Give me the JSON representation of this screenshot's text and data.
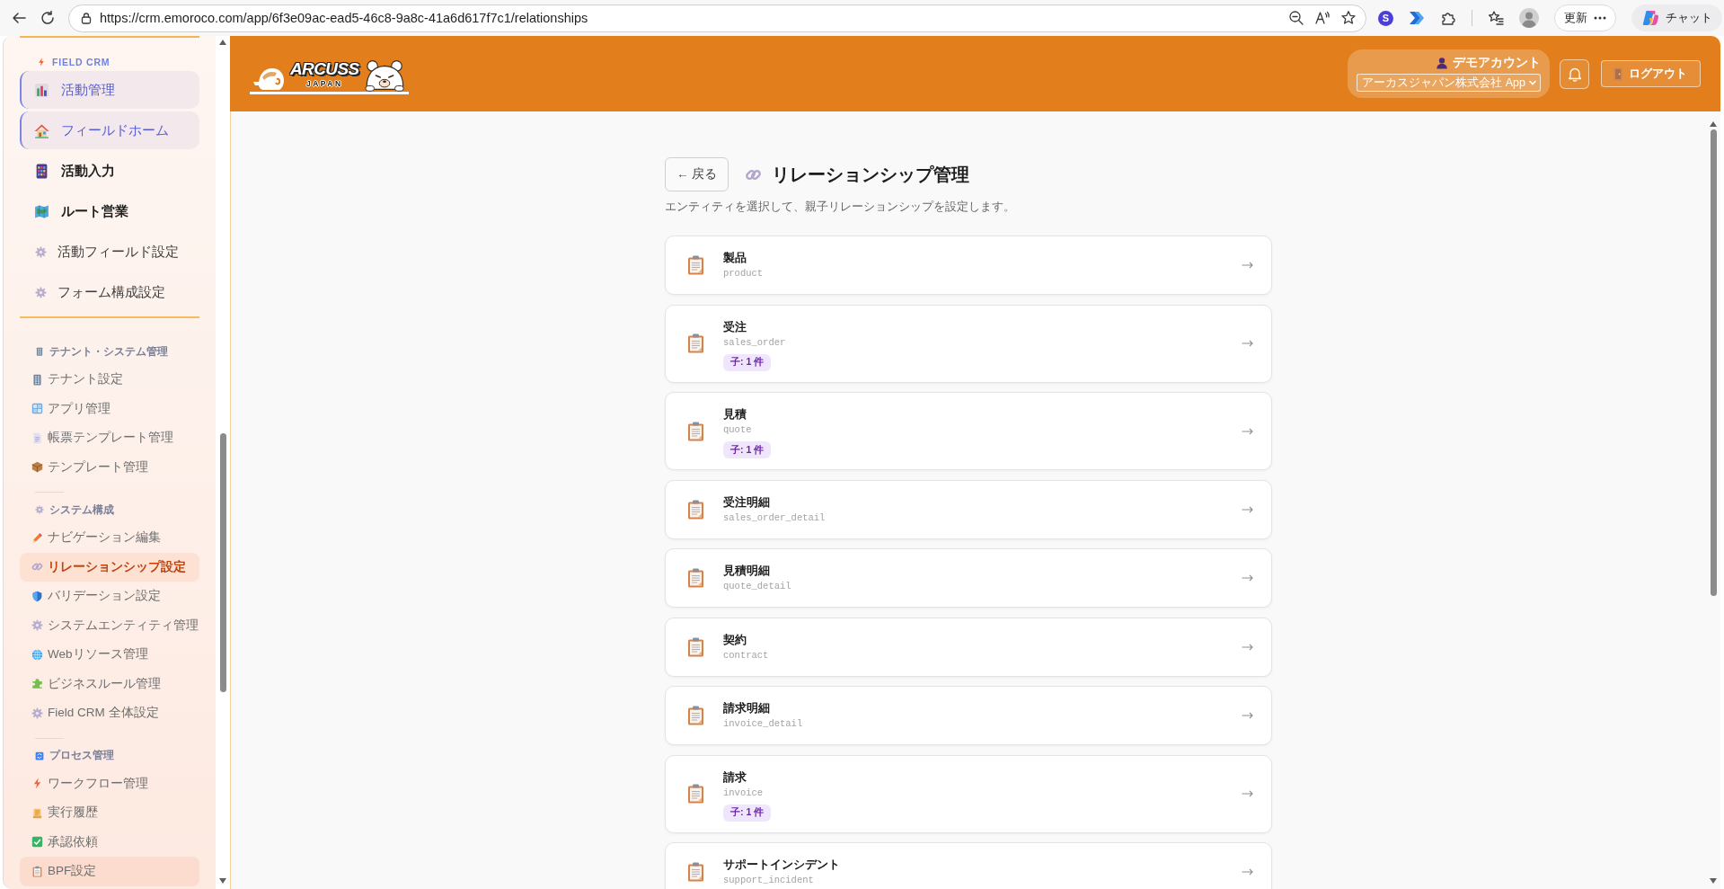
{
  "browser": {
    "url": "https://crm.emoroco.com/app/6f3e09ac-ead5-46c8-9a8c-41a6d617f7c1/relationships",
    "extension_letter": "S",
    "update_button": "更新",
    "chat_button": "チャット"
  },
  "sidebar": {
    "section_label": "FIELD CRM",
    "items": [
      {
        "label": "活動管理",
        "kind": "featured"
      },
      {
        "label": "フィールドホーム",
        "kind": "featured"
      },
      {
        "label": "活動入力",
        "kind": "primary"
      },
      {
        "label": "ルート営業",
        "kind": "primary"
      },
      {
        "label": "活動フィールド設定",
        "kind": "setting"
      },
      {
        "label": "フォーム構成設定",
        "kind": "setting"
      }
    ],
    "groups": [
      {
        "title": "テナント・システム管理",
        "items": [
          {
            "label": "テナント設定",
            "selected": false,
            "hovered": false
          },
          {
            "label": "アプリ管理",
            "selected": false,
            "hovered": false
          },
          {
            "label": "帳票テンプレート管理",
            "selected": false,
            "hovered": false
          },
          {
            "label": "テンプレート管理",
            "selected": false,
            "hovered": false
          }
        ]
      },
      {
        "title": "システム構成",
        "items": [
          {
            "label": "ナビゲーション編集",
            "selected": false,
            "hovered": false
          },
          {
            "label": "リレーションシップ設定",
            "selected": true,
            "hovered": false
          },
          {
            "label": "バリデーション設定",
            "selected": false,
            "hovered": false
          },
          {
            "label": "システムエンティティ管理",
            "selected": false,
            "hovered": false
          },
          {
            "label": "Webリソース管理",
            "selected": false,
            "hovered": false
          },
          {
            "label": "ビジネスルール管理",
            "selected": false,
            "hovered": false
          },
          {
            "label": "Field CRM 全体設定",
            "selected": false,
            "hovered": false
          }
        ]
      },
      {
        "title": "プロセス管理",
        "items": [
          {
            "label": "ワークフロー管理",
            "selected": false,
            "hovered": false
          },
          {
            "label": "実行履歴",
            "selected": false,
            "hovered": false
          },
          {
            "label": "承認依頼",
            "selected": false,
            "hovered": false
          },
          {
            "label": "BPF設定",
            "selected": false,
            "hovered": true
          }
        ]
      }
    ]
  },
  "header": {
    "logo": {
      "wordmark": "ARCUSS",
      "tagline": "JAPAN"
    },
    "account_name": "デモアカウント",
    "app_select": "アーカスジャパン株式会社 App",
    "logout_button": "ログアウト"
  },
  "page": {
    "back_button": "← 戻る",
    "title": "リレーションシップ管理",
    "subtitle": "エンティティを選択して、親子リレーションシップを設定します。"
  },
  "entities": [
    {
      "name": "製品",
      "key": "product"
    },
    {
      "name": "受注",
      "key": "sales_order",
      "badge": "子: 1 件"
    },
    {
      "name": "見積",
      "key": "quote",
      "badge": "子: 1 件"
    },
    {
      "name": "受注明細",
      "key": "sales_order_detail"
    },
    {
      "name": "見積明細",
      "key": "quote_detail"
    },
    {
      "name": "契約",
      "key": "contract"
    },
    {
      "name": "請求明細",
      "key": "invoice_detail"
    },
    {
      "name": "請求",
      "key": "invoice",
      "badge": "子: 1 件"
    },
    {
      "name": "サポートインシデント",
      "key": "support_incident"
    }
  ]
}
